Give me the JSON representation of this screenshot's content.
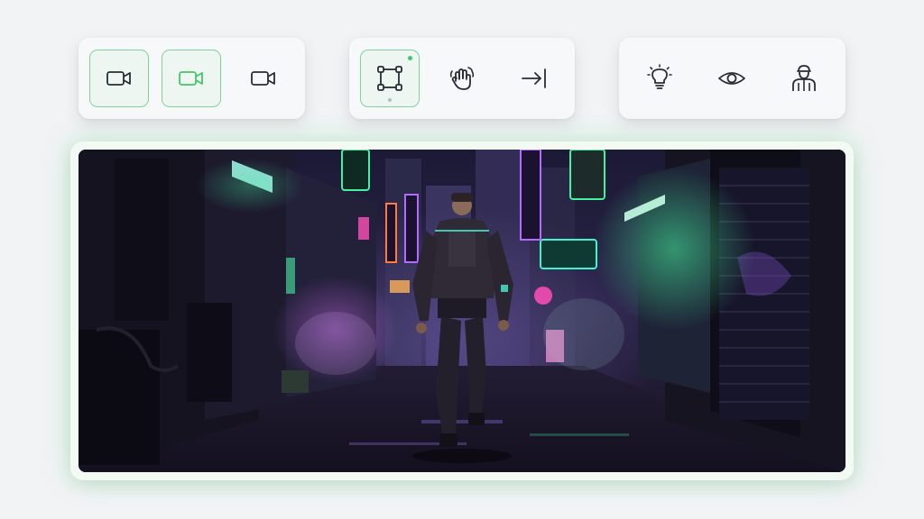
{
  "colors": {
    "accent": "#45c46a",
    "active_border": "#7fd49a",
    "icon_stroke": "#2b2b36",
    "neon_green": "#45f0a0",
    "neon_purple": "#b36bff",
    "neon_pink": "#ff4fb8"
  },
  "toolbars": [
    {
      "group": "camera",
      "tools": [
        {
          "icon": "video-camera-icon",
          "active": true
        },
        {
          "icon": "video-camera-icon",
          "active": true,
          "tint": "green"
        },
        {
          "icon": "video-camera-icon",
          "active": false
        }
      ]
    },
    {
      "group": "edit",
      "tools": [
        {
          "icon": "node-path-icon",
          "active": true
        },
        {
          "icon": "hand-gesture-icon",
          "active": false
        },
        {
          "icon": "arrow-to-end-icon",
          "active": false
        }
      ]
    },
    {
      "group": "scene",
      "tools": [
        {
          "icon": "lightbulb-icon",
          "active": false
        },
        {
          "icon": "eye-icon",
          "active": false
        },
        {
          "icon": "character-icon",
          "active": false
        }
      ]
    }
  ],
  "viewport": {
    "scene": "neon-alley-night"
  }
}
